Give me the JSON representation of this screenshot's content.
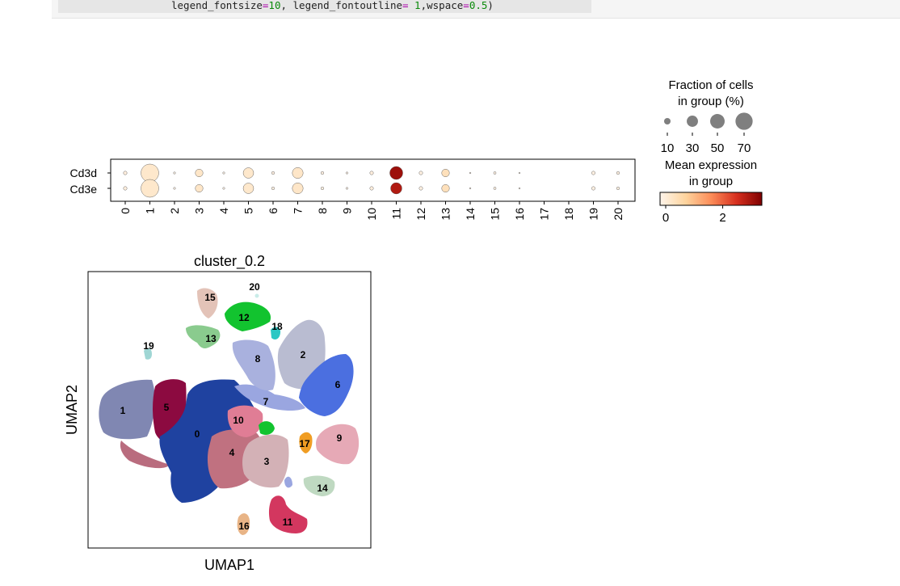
{
  "code": {
    "parts": [
      {
        "t": "legend_fontsize",
        "c": "kw"
      },
      {
        "t": "=",
        "c": "op"
      },
      {
        "t": "10",
        "c": "num"
      },
      {
        "t": ", legend_fontoutline",
        "c": "kw"
      },
      {
        "t": "=",
        "c": "op"
      },
      {
        "t": " 1",
        "c": "num"
      },
      {
        "t": ",wspace",
        "c": "kw"
      },
      {
        "t": "=",
        "c": "op"
      },
      {
        "t": "0.5",
        "c": "num"
      },
      {
        "t": ")",
        "c": "kw"
      }
    ]
  },
  "dotplot": {
    "genes": [
      "Cd3d",
      "Cd3e"
    ],
    "groups": [
      "0",
      "1",
      "2",
      "3",
      "4",
      "5",
      "6",
      "7",
      "8",
      "9",
      "10",
      "11",
      "12",
      "13",
      "14",
      "15",
      "16",
      "17",
      "18",
      "19",
      "20"
    ],
    "fraction_pct": [
      [
        3,
        75,
        1,
        14,
        1,
        26,
        2,
        28,
        2,
        1,
        3,
        40,
        3,
        14,
        0.5,
        1.5,
        0.5,
        0,
        0,
        3,
        2
      ],
      [
        3,
        75,
        1,
        14,
        1,
        26,
        2,
        28,
        2,
        1,
        3,
        30,
        3,
        14,
        0.5,
        1.5,
        0.5,
        0,
        0,
        3,
        2
      ]
    ],
    "mean_expr": [
      [
        0.15,
        0.35,
        0.05,
        0.4,
        0.05,
        0.35,
        0.1,
        0.4,
        0.1,
        0.05,
        0.15,
        3.2,
        0.1,
        0.55,
        0.1,
        0.1,
        0.05,
        0,
        0,
        0.1,
        0.1
      ],
      [
        0.15,
        0.35,
        0.05,
        0.4,
        0.05,
        0.35,
        0.1,
        0.4,
        0.1,
        0.05,
        0.15,
        3.0,
        0.1,
        0.55,
        0.1,
        0.1,
        0.05,
        0,
        0,
        0.1,
        0.1
      ]
    ],
    "legend": {
      "size_title_1": "Fraction of cells",
      "size_title_2": "in group (%)",
      "size_values": [
        10,
        30,
        50,
        70
      ],
      "color_title_1": "Mean expression",
      "color_title_2": "in group",
      "color_ticks": [
        0,
        2
      ],
      "color_max": 3.5,
      "colormap": "Reds",
      "dot_color": "#7f7f7f"
    }
  },
  "umap": {
    "title": "cluster_0.2",
    "xlabel": "UMAP1",
    "ylabel": "UMAP2",
    "clusters": [
      {
        "id": "0",
        "color": "#1f42a0"
      },
      {
        "id": "1",
        "color": "#8087b2"
      },
      {
        "id": "2",
        "color": "#b9bcd1"
      },
      {
        "id": "3",
        "color": "#d3b1b6"
      },
      {
        "id": "4",
        "color": "#c07180"
      },
      {
        "id": "5",
        "color": "#8c0a40"
      },
      {
        "id": "6",
        "color": "#4b6fe0"
      },
      {
        "id": "7",
        "color": "#9aa6e0"
      },
      {
        "id": "8",
        "color": "#a9b1de"
      },
      {
        "id": "9",
        "color": "#e6a9b6"
      },
      {
        "id": "10",
        "color": "#e07d95"
      },
      {
        "id": "11",
        "color": "#d3375f"
      },
      {
        "id": "12",
        "color": "#12c32f"
      },
      {
        "id": "13",
        "color": "#8acb8e"
      },
      {
        "id": "14",
        "color": "#bfd9c1"
      },
      {
        "id": "15",
        "color": "#e3c3b8"
      },
      {
        "id": "16",
        "color": "#e8b486"
      },
      {
        "id": "17",
        "color": "#f09d23"
      },
      {
        "id": "18",
        "color": "#2bc7c4"
      },
      {
        "id": "19",
        "color": "#9fd6d4"
      },
      {
        "id": "20",
        "color": "#c9ece8"
      }
    ]
  }
}
